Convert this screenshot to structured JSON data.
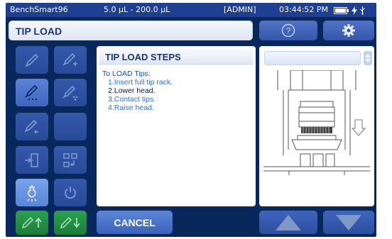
{
  "status_bar": {
    "device": "BenchSmart96",
    "volume_range": "5.0 µL - 200.0 µL",
    "user": "[ADMIN]",
    "time": "03:44:52 PM",
    "icons": [
      "battery-icon",
      "charging-icon",
      "usb-icon"
    ]
  },
  "header": {
    "title": "TIP LOAD",
    "help_icon": "help-icon",
    "settings_icon": "gear-icon"
  },
  "tools": [
    {
      "icon": "pipette-icon",
      "state": "normal"
    },
    {
      "icon": "pipette-add-icon",
      "state": "normal"
    },
    {
      "icon": "pipette-dispense-icon",
      "state": "selected"
    },
    {
      "icon": "pipette-mix-icon",
      "state": "normal"
    },
    {
      "icon": "pipette-back-icon",
      "state": "normal"
    },
    {
      "icon": "blank",
      "state": "normal"
    },
    {
      "icon": "door-exit-icon",
      "state": "normal"
    },
    {
      "icon": "plate-transfer-icon",
      "state": "normal"
    },
    {
      "icon": "light-bulb-icon",
      "state": "active"
    },
    {
      "icon": "power-icon",
      "state": "normal"
    },
    {
      "icon": "tip-eject-up-icon",
      "state": "green"
    },
    {
      "icon": "tip-load-down-icon",
      "state": "green"
    }
  ],
  "steps_panel": {
    "heading": "TIP LOAD STEPS",
    "intro": "To LOAD Tips:",
    "steps": [
      {
        "text": "1.Insert full tip rack.",
        "active": false
      },
      {
        "text": "2.Lower head.",
        "active": true
      },
      {
        "text": "3.Contact tips.",
        "active": false
      },
      {
        "text": "4.Raise head.",
        "active": false
      }
    ]
  },
  "image_panel": {
    "selector_value": "",
    "illustration": "pipetting-head-lowering-illustration"
  },
  "footer": {
    "cancel_label": "CANCEL",
    "up_icon": "triangle-up-icon",
    "down_icon": "triangle-down-icon"
  },
  "colors": {
    "screen_bg": "#08275a",
    "status_bar": "#1f3f93",
    "button_blue": "#3558ab",
    "button_green": "#1f8a42",
    "accent_text": "#1d3574"
  }
}
